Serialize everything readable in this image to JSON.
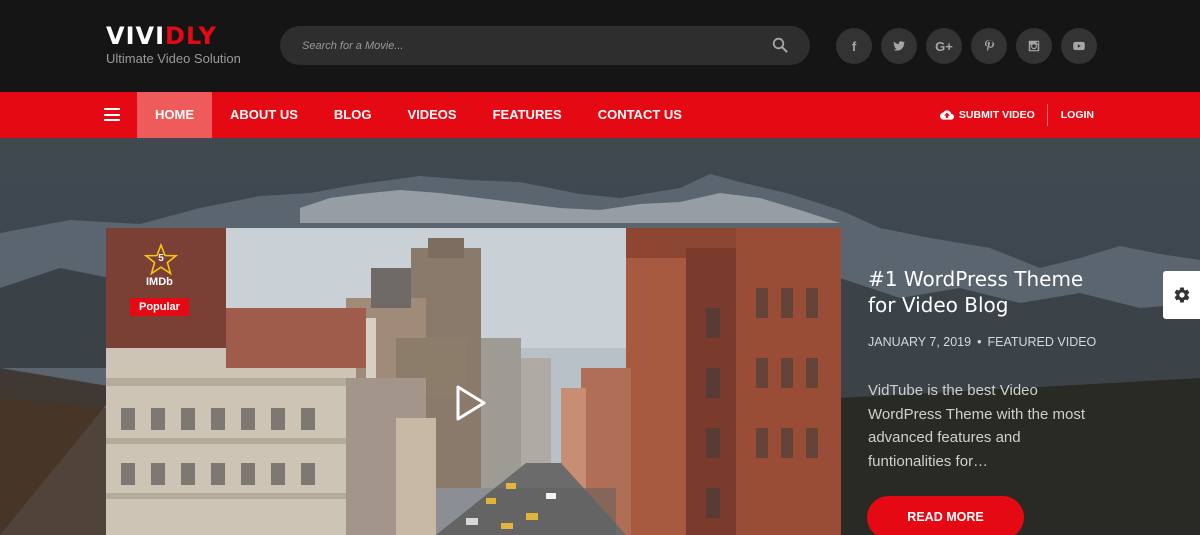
{
  "brand": {
    "name_part1": "VIVI",
    "name_part2": "DLY",
    "tagline": "Ultimate Video Solution",
    "accent_color": "#e50914"
  },
  "search": {
    "placeholder": "Search for a Movie...",
    "value": ""
  },
  "social": [
    {
      "icon": "facebook-icon",
      "glyph": "f"
    },
    {
      "icon": "twitter-icon",
      "glyph": ""
    },
    {
      "icon": "google-plus-icon",
      "glyph": "G+"
    },
    {
      "icon": "pinterest-icon",
      "glyph": "℗"
    },
    {
      "icon": "instagram-icon",
      "glyph": ""
    },
    {
      "icon": "youtube-icon",
      "glyph": ""
    }
  ],
  "nav": {
    "items": [
      {
        "label": "HOME",
        "active": true
      },
      {
        "label": "ABOUT US",
        "active": false
      },
      {
        "label": "BLOG",
        "active": false
      },
      {
        "label": "VIDEOS",
        "active": false
      },
      {
        "label": "FEATURES",
        "active": false
      },
      {
        "label": "CONTACT US",
        "active": false
      }
    ],
    "submit_label": "SUBMIT VIDEO",
    "login_label": "LOGIN"
  },
  "featured": {
    "rating": "5",
    "rating_source": "IMDb",
    "badge": "Popular",
    "title": "#1 WordPress Theme for Video Blog",
    "date": "JANUARY 7, 2019",
    "category": "FEATURED VIDEO",
    "excerpt": "VidTube is the best Video WordPress Theme with the most advanced features and funtionalities for…",
    "cta_label": "READ MORE"
  }
}
